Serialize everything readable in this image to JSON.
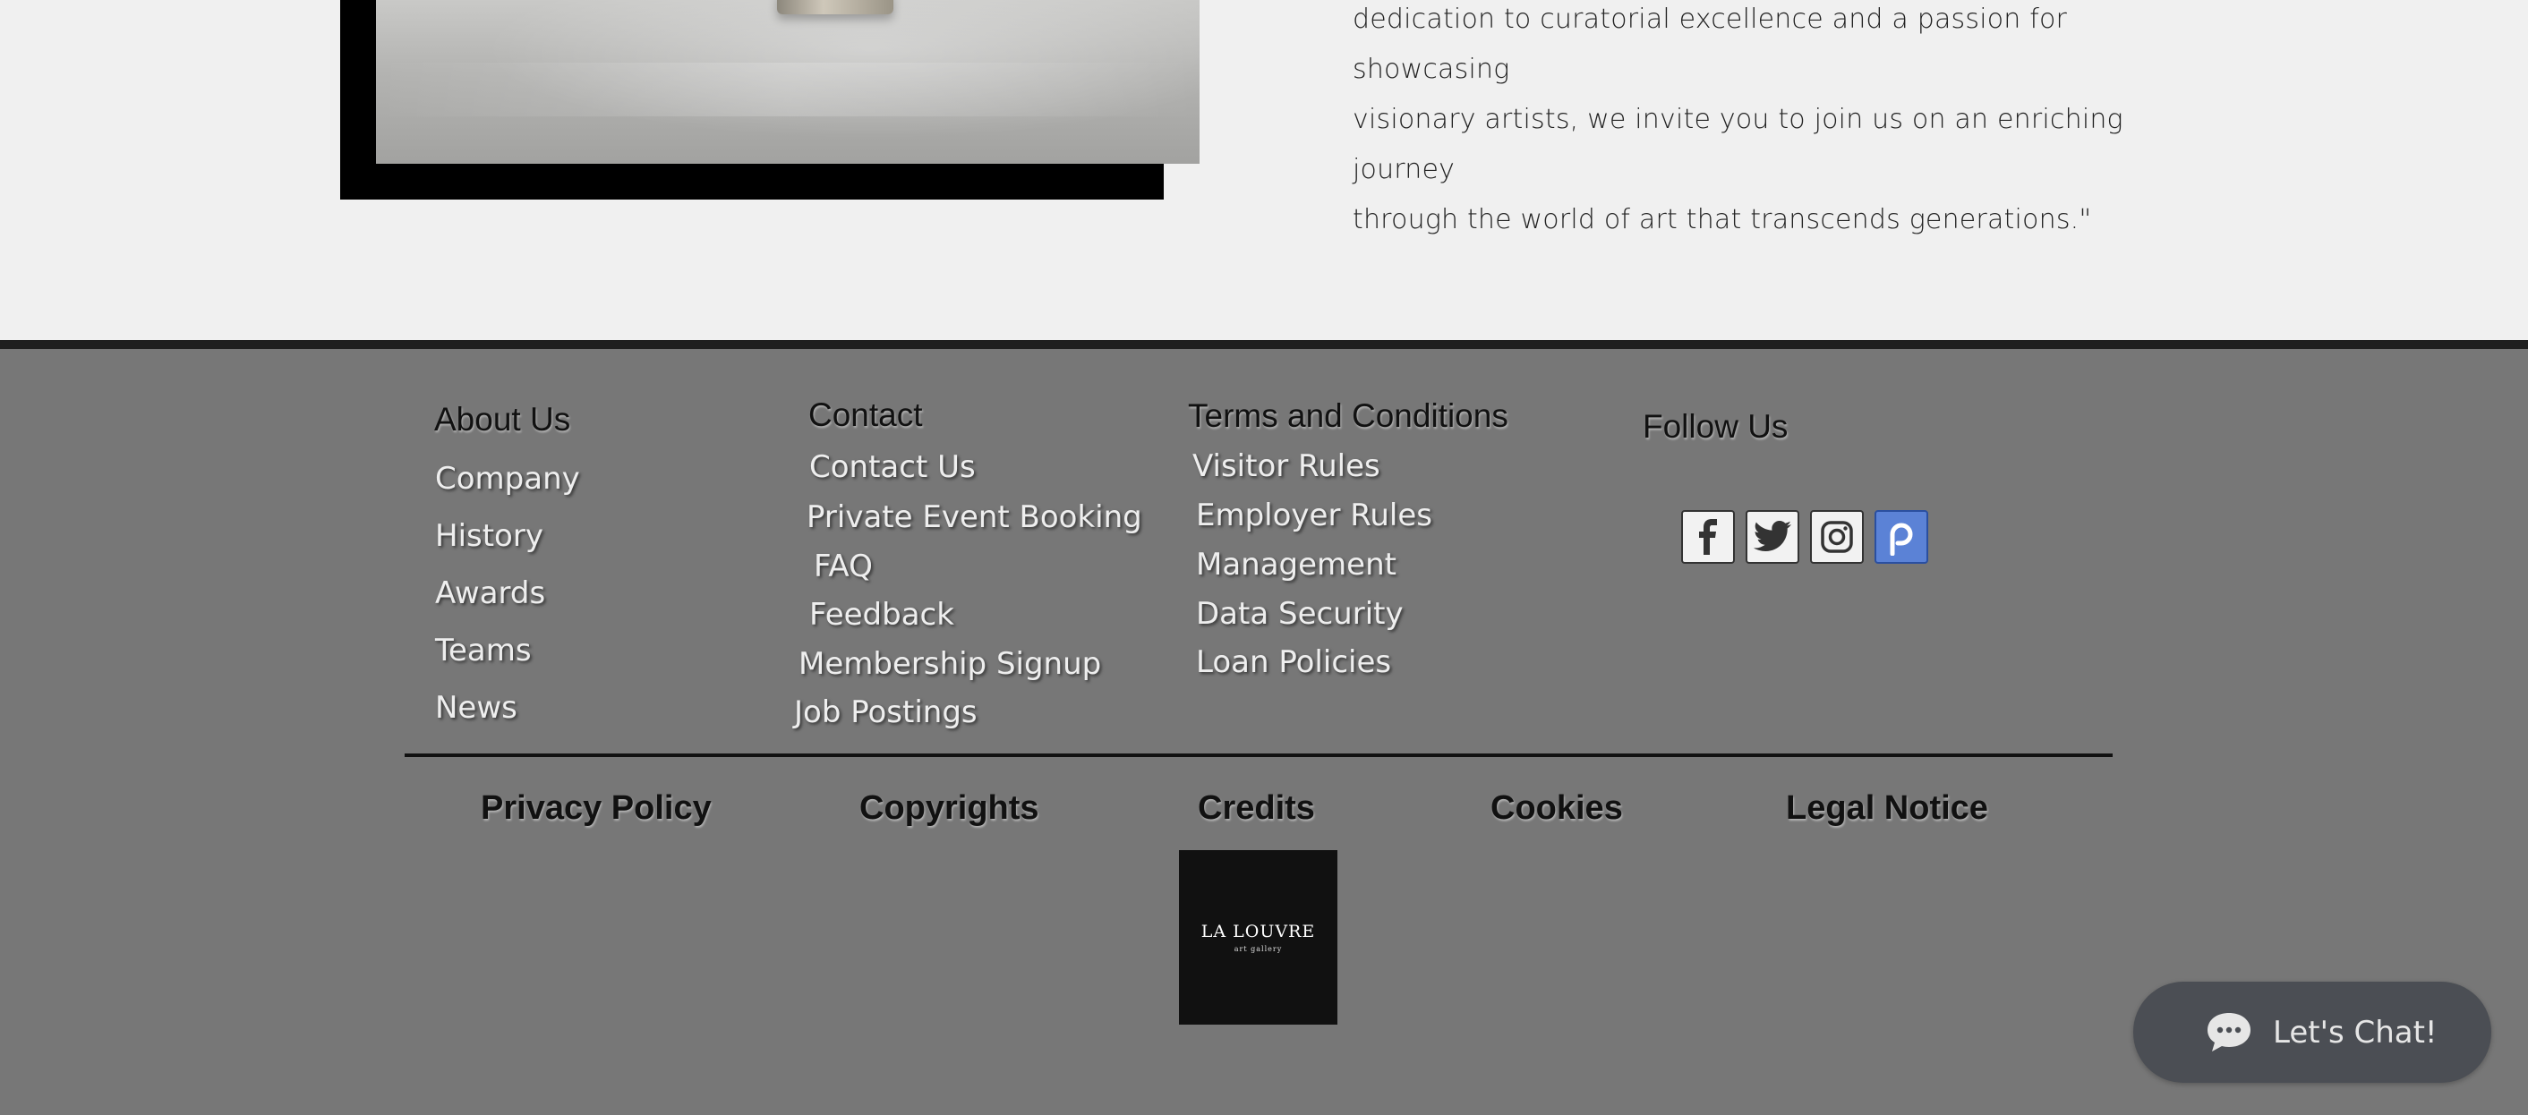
{
  "intro": {
    "quote": "dedication to curatorial excellence and a passion for showcasing\nvisionary artists, we invite you to join us on an enriching journey\nthrough the world of art that transcends generations.\""
  },
  "footer": {
    "about": {
      "heading": "About Us",
      "links": [
        "Company",
        "History",
        "Awards",
        "Teams",
        "News"
      ]
    },
    "contact": {
      "heading": "Contact",
      "links": [
        "Contact Us",
        "Private Event Booking",
        "FAQ",
        "Feedback",
        "Membership Signup",
        "Job Postings"
      ]
    },
    "terms": {
      "heading": "Terms and Conditions",
      "links": [
        "Visitor Rules",
        "Employer Rules",
        "Management",
        "Data Security",
        "Loan Policies"
      ]
    },
    "follow": {
      "heading": "Follow Us",
      "icons": [
        "facebook-icon",
        "twitter-icon",
        "instagram-icon",
        "patreon-icon"
      ]
    },
    "bottom_links": [
      "Privacy Policy",
      "Copyrights",
      "Credits",
      "Cookies",
      "Legal Notice"
    ],
    "logo": {
      "title": "LA LOUVRE",
      "subtitle": "art gallery"
    }
  },
  "chat": {
    "label": "Let's Chat!"
  },
  "colors": {
    "footer_bg": "#777777",
    "social_accent": "#5b82d6",
    "chat_bg": "#4b4e54"
  }
}
